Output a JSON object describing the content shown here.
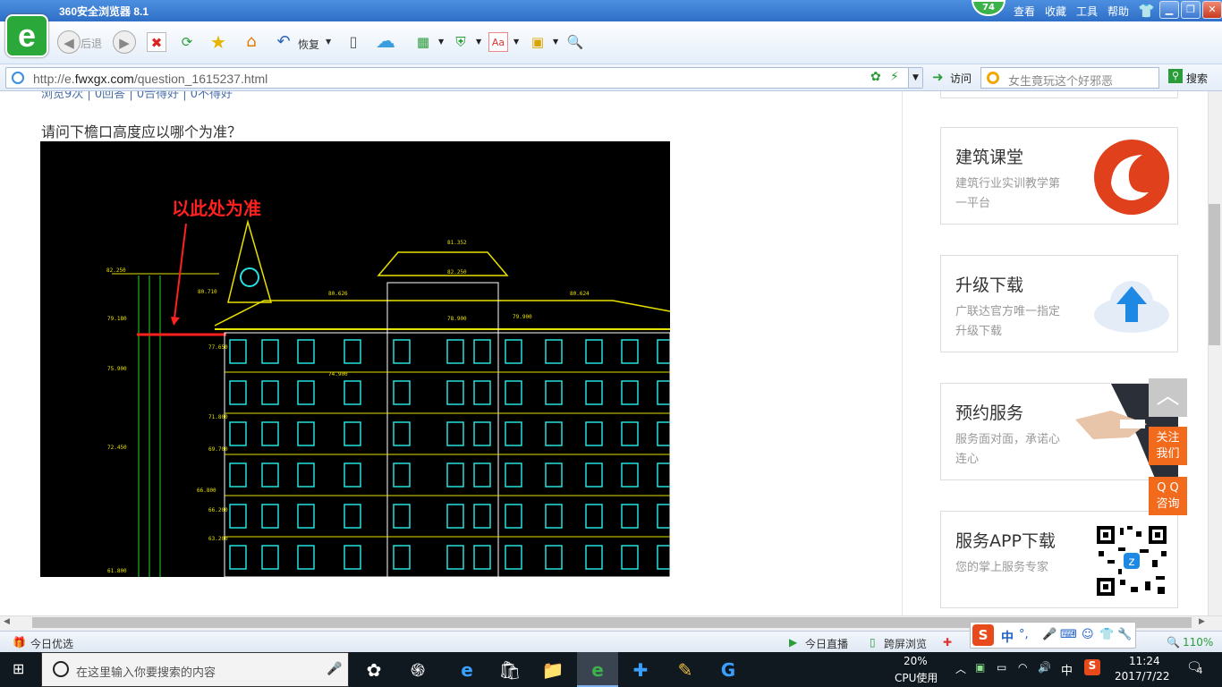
{
  "window": {
    "title": "360安全浏览器 8.1",
    "badge": "74",
    "menu": [
      "查看",
      "收藏",
      "工具",
      "帮助"
    ]
  },
  "toolbar": {
    "back_label": "后退",
    "restore_label": "恢复"
  },
  "address": {
    "url_prefix": "http://e.",
    "url_domain": "fwxgx.com",
    "url_path": "/question_1615237.html",
    "visit_label": "访问"
  },
  "search": {
    "placeholder": "女生竟玩这个好邪恶",
    "button": "搜索"
  },
  "page": {
    "meta_line": "浏览9次 | 0回答 | 0合得好 | 0不得好",
    "question": "请问下檐口高度应以哪个为准？",
    "cad_annotation": "以此处为准",
    "cad_elevations": [
      "82.250",
      "81.352",
      "82.250",
      "80.626",
      "80.624",
      "80.710",
      "78.900",
      "79.180",
      "79.900",
      "77.650",
      "75.900",
      "74.900",
      "71.800",
      "72.450",
      "69.700",
      "66.800",
      "66.200",
      "63.200",
      "61.800"
    ]
  },
  "sidebar": {
    "cards": [
      {
        "title": "建筑课堂",
        "desc": "建筑行业实训教学第一平台"
      },
      {
        "title": "升级下载",
        "desc": "广联达官方唯一指定升级下载"
      },
      {
        "title": "预约服务",
        "desc": "服务面对面，承诺心连心"
      },
      {
        "title": "服务APP下载",
        "desc": "您的掌上服务专家"
      }
    ],
    "float_buttons": [
      {
        "line1": "关注",
        "line2": "我们"
      },
      {
        "line1": "Q Q",
        "line2": "咨询"
      }
    ]
  },
  "statusbar": {
    "left": "今日优选",
    "live": "今日直播",
    "cross_screen": "跨屏浏览",
    "zoom": "110%",
    "ime_lang": "中"
  },
  "taskbar": {
    "search_placeholder": "在这里输入你要搜索的内容",
    "cpu_pct": "20%",
    "cpu_label": "CPU使用",
    "ime": "中",
    "time": "11:24",
    "date": "2017/7/22",
    "notifications": "4"
  },
  "colors": {
    "orange": "#f26a1b",
    "red_logo": "#e0401b",
    "cloud_blue": "#1e88e5",
    "cad_yellow": "#e8e000",
    "cad_cyan": "#27e0e0",
    "cad_green": "#26d826"
  }
}
